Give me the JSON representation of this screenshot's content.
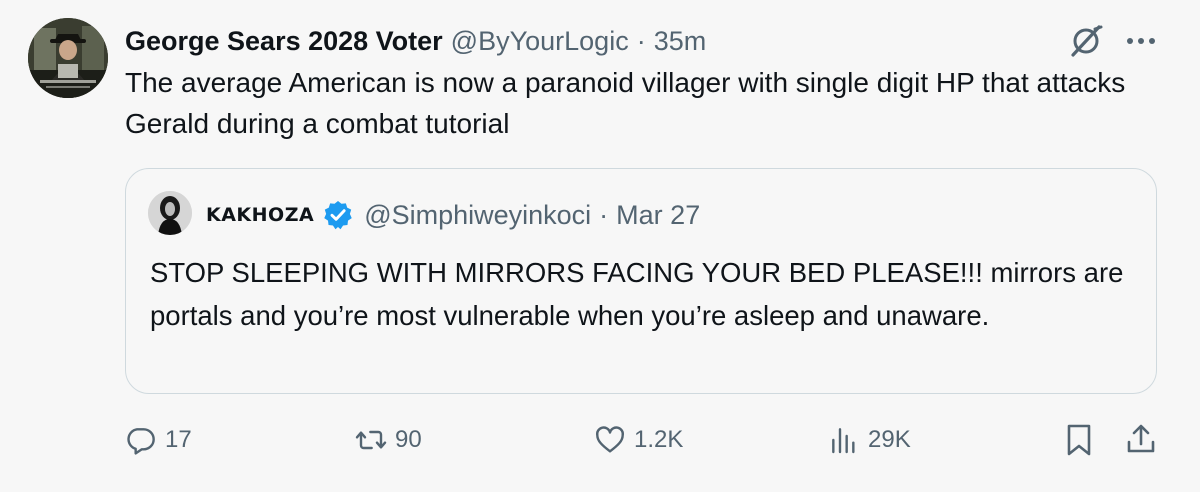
{
  "author": {
    "display_name": "George Sears 2028 Voter",
    "handle": "@ByYourLogic",
    "separator": "·",
    "time": "35m",
    "avatar": "avatar-man-in-hat"
  },
  "tweet": {
    "text": "The average American is now a paranoid villager with single digit HP that attacks Gerald during a combat tutorial"
  },
  "quoted": {
    "display_name": "KAKHOZA",
    "verified": true,
    "handle": "@Simphiweyinkoci",
    "separator": "·",
    "date": "Mar 27",
    "text": "STOP SLEEPING WITH MIRRORS FACING YOUR BED PLEASE!!! mirrors are portals and you’re most vulnerable when you’re asleep and unaware.",
    "avatar": "avatar-woman-bw"
  },
  "actions": {
    "replies": "17",
    "reposts": "90",
    "likes": "1.2K",
    "views": "29K"
  },
  "icons": {
    "grok": "grok-icon",
    "more": "more-icon",
    "verified": "verified-badge-icon",
    "reply": "reply-icon",
    "repost": "repost-icon",
    "like": "heart-icon",
    "views": "views-icon",
    "bookmark": "bookmark-icon",
    "share": "share-icon"
  },
  "colors": {
    "background": "#f7f7f7",
    "text_primary": "#0f1419",
    "text_secondary": "#536471",
    "border": "#cfd9de",
    "verified_blue": "#1d9bf0"
  }
}
